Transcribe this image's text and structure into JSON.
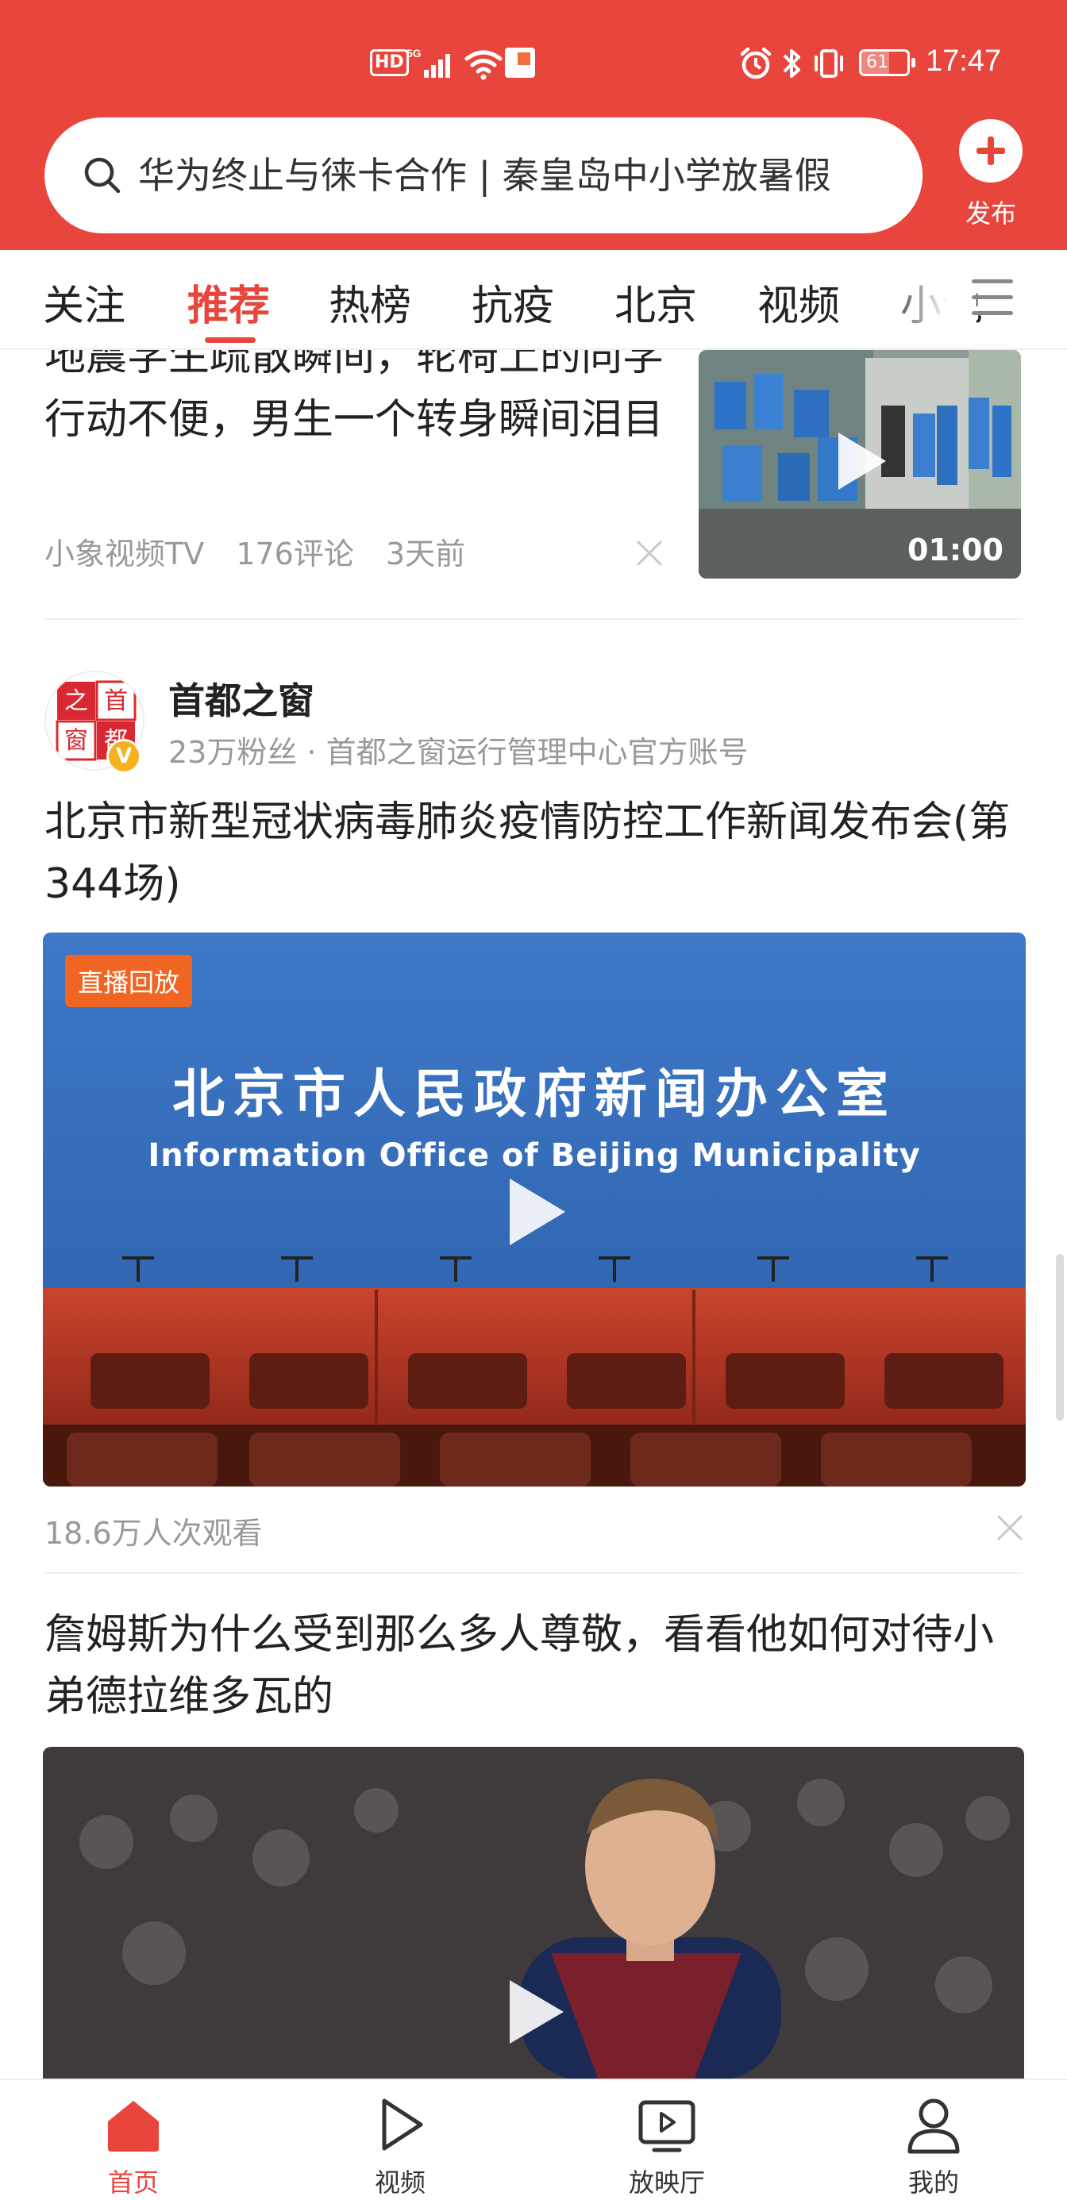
{
  "status_bar": {
    "hd": "HD",
    "network": "5G",
    "battery": "61",
    "time": "17:47"
  },
  "search": {
    "text": "华为终止与徕卡合作 | 秦皇岛中小学放暑假"
  },
  "publish": {
    "label": "发布"
  },
  "tabs": [
    "关注",
    "推荐",
    "热榜",
    "抗疫",
    "北京",
    "视频",
    "小说"
  ],
  "active_tab": "推荐",
  "feed": {
    "item1": {
      "title": "地震学生疏散瞬间，轮椅上的同学行动不便，男生一个转身瞬间泪目",
      "source": "小象视频TV",
      "comments": "176评论",
      "time": "3天前",
      "duration": "01:00"
    },
    "item2": {
      "author": "首都之窗",
      "author_desc": "23万粉丝 · 首都之窗运行管理中心官方账号",
      "verified": "V",
      "title": "北京市新型冠状病毒肺炎疫情防控工作新闻发布会(第344场)",
      "badge": "直播回放",
      "banner_cn": "北京市人民政府新闻办公室",
      "banner_en": "Information Office of Beijing Municipality",
      "views": "18.6万人次观看"
    },
    "item3": {
      "title": "詹姆斯为什么受到那么多人尊敬，看看他如何对待小弟德拉维多瓦的"
    }
  },
  "bottom_nav": [
    {
      "label": "首页",
      "icon": "home-icon"
    },
    {
      "label": "视频",
      "icon": "play-icon"
    },
    {
      "label": "放映厅",
      "icon": "tv-icon"
    },
    {
      "label": "我的",
      "icon": "user-icon"
    }
  ],
  "colors": {
    "brand": "#e8453c",
    "live_badge": "#f06522",
    "verified": "#f5b21c"
  }
}
